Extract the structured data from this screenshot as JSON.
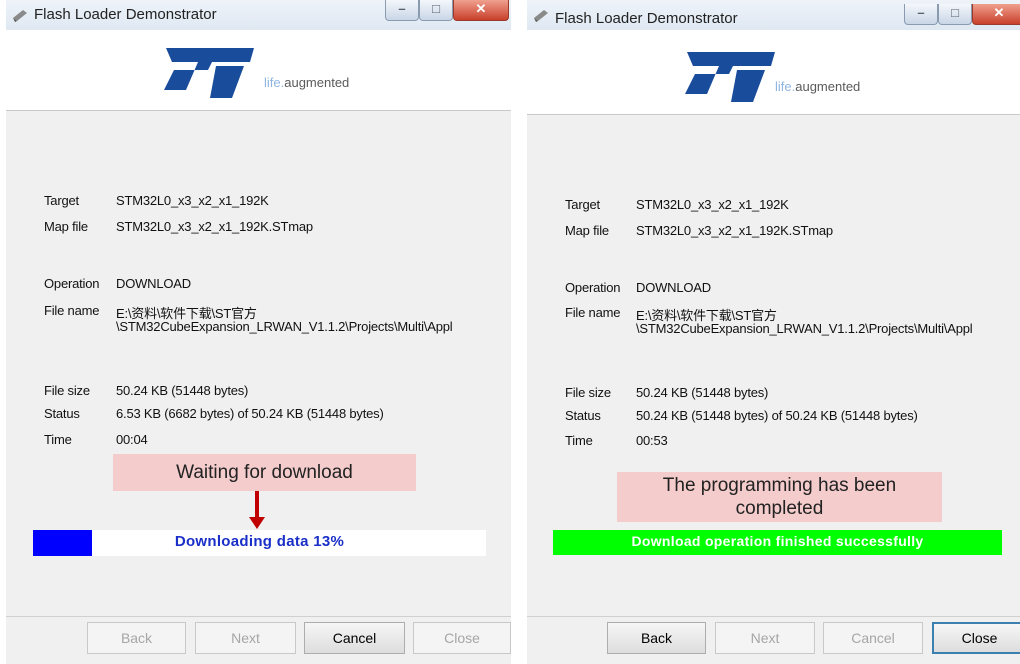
{
  "left": {
    "title": "Flash Loader Demonstrator",
    "logo_tag_1": "life.",
    "logo_tag_2": "augmented",
    "labels": {
      "target": "Target",
      "map_file": "Map file",
      "operation": "Operation",
      "file_name": "File name",
      "file_size": "File size",
      "status": "Status",
      "time": "Time"
    },
    "target": "STM32L0_x3_x2_x1_192K",
    "map_file": "STM32L0_x3_x2_x1_192K.STmap",
    "operation": "DOWNLOAD",
    "file_name_1": "E:\\资料\\软件下载\\ST官方",
    "file_name_2": "\\STM32CubeExpansion_LRWAN_V1.1.2\\Projects\\Multi\\Appl",
    "file_size": "50.24 KB (51448 bytes)",
    "status": "6.53 KB (6682 bytes) of 50.24 KB (51448 bytes)",
    "time": "00:04",
    "note": "Waiting for download",
    "progress_text": "Downloading data 13%",
    "progress_fraction": 0.13,
    "buttons": {
      "back": "Back",
      "next": "Next",
      "cancel": "Cancel",
      "close": "Close"
    }
  },
  "right": {
    "title": "Flash Loader Demonstrator",
    "logo_tag_1": "life.",
    "logo_tag_2": "augmented",
    "labels": {
      "target": "Target",
      "map_file": "Map file",
      "operation": "Operation",
      "file_name": "File name",
      "file_size": "File size",
      "status": "Status",
      "time": "Time"
    },
    "target": "STM32L0_x3_x2_x1_192K",
    "map_file": "STM32L0_x3_x2_x1_192K.STmap",
    "operation": "DOWNLOAD",
    "file_name_1": "E:\\资料\\软件下载\\ST官方",
    "file_name_2": "\\STM32CubeExpansion_LRWAN_V1.1.2\\Projects\\Multi\\Appl",
    "file_size": "50.24 KB (51448 bytes)",
    "status": "50.24 KB (51448 bytes) of 50.24 KB (51448 bytes)",
    "time": "00:53",
    "note_1": "The programming has been",
    "note_2": "completed",
    "progress_text": "Download operation finished successfully",
    "buttons": {
      "back": "Back",
      "next": "Next",
      "cancel": "Cancel",
      "close": "Close"
    }
  },
  "colors": {
    "progress_blue": "#0000ff",
    "progress_green": "#00ff00",
    "note_bg": "#f4cccc",
    "arrow": "#c00000",
    "st_blue": "#1a4c9c"
  }
}
